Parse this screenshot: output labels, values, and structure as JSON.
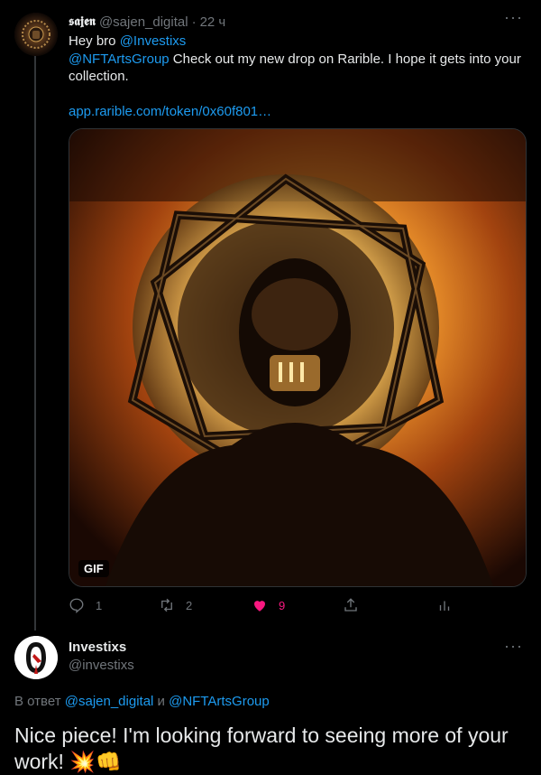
{
  "tweet": {
    "author_name": "𝖘𝖆𝖏𝖊𝖓",
    "author_handle": "@sajen_digital",
    "separator": "·",
    "time": "22 ч",
    "text_line1_prefix": "Hey bro ",
    "mention1": "@Investixs",
    "mention2": "@NFTArtsGroup",
    "text_body": "  Check out my new drop on Rarible. I hope it gets into your collection.",
    "link": "app.rarible.com/token/0x60f801…",
    "media_badge": "GIF",
    "actions": {
      "reply_count": "1",
      "retweet_count": "2",
      "like_count": "9"
    }
  },
  "reply": {
    "author_name": "Investixs",
    "author_handle": "@investixs",
    "reply_prefix": "В ответ ",
    "reply_mention1": "@sajen_digital",
    "reply_and": " и ",
    "reply_mention2": "@NFTArtsGroup",
    "text": "Nice piece! I'm looking forward to seeing more of your work! 💥👊"
  },
  "colors": {
    "background": "#000000",
    "text": "#e7e9ea",
    "muted": "#71767b",
    "link": "#1d9bf0",
    "like": "#f91880"
  }
}
